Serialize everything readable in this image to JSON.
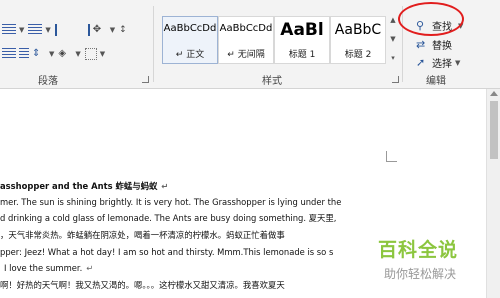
{
  "ribbon": {
    "paragraph_group_label": "段落",
    "styles_group_label": "样式",
    "editing_group_label": "编辑",
    "styles": [
      {
        "preview": "AaBbCcDd",
        "name": "↵ 正文",
        "selected": true
      },
      {
        "preview": "AaBbCcDd",
        "name": "↵ 无间隔",
        "selected": false
      },
      {
        "preview": "AaBl",
        "name": "标题 1",
        "selected": false
      },
      {
        "preview": "AaBbC",
        "name": "标题 2",
        "selected": false
      }
    ],
    "editing": {
      "find_label": "查找",
      "replace_label": "替换",
      "select_label": "选择"
    },
    "icons": [
      "bullets-icon",
      "numbering-icon",
      "multilevel-icon",
      "decrease-indent-icon",
      "increase-indent-icon",
      "chinese-layout-icon",
      "sort-icon",
      "show-marks-icon",
      "align-left-icon",
      "align-center-icon",
      "align-right-icon",
      "justify-icon",
      "line-spacing-icon",
      "shading-icon",
      "borders-icon",
      "search-icon",
      "replace-icon",
      "select-icon"
    ]
  },
  "document": {
    "lines": [
      {
        "text": "asshopper and the Ants  蚱蜢与蚂蚁",
        "mark": "↵",
        "heading": true
      },
      {
        "text": "mer. The sun is shining brightly. It is very hot. The Grasshopper is lying under the",
        "mark": "",
        "heading": false
      },
      {
        "text": "d drinking a cold glass of lemonade. The Ants are busy doing something.  夏天里,",
        "mark": "",
        "heading": false
      },
      {
        "text": "，天气非常炎热。蚱蜢躺在阴凉处，喝着一杯清凉的柠檬水。蚂蚁正忙着做事",
        "mark": "",
        "heading": false
      },
      {
        "text": "pper: Jeez! What a hot day! I am so hot and thirsty. Mmm.This lemonade is so s",
        "mark": "",
        "heading": false
      },
      {
        "text": "I love the summer.",
        "mark": "↵",
        "heading": false
      },
      {
        "text": "啊！好热的天气啊！我又热又渴的。嗯。。。这柠檬水又甜又清凉。我喜欢夏天",
        "mark": "",
        "heading": false
      }
    ]
  },
  "watermark": {
    "title": "百科全说",
    "subtitle": "助你轻松解决"
  },
  "colors": {
    "annotation_circle": "#e11d1d",
    "accent_blue": "#2b579a",
    "watermark_green": "#8cc63f"
  }
}
